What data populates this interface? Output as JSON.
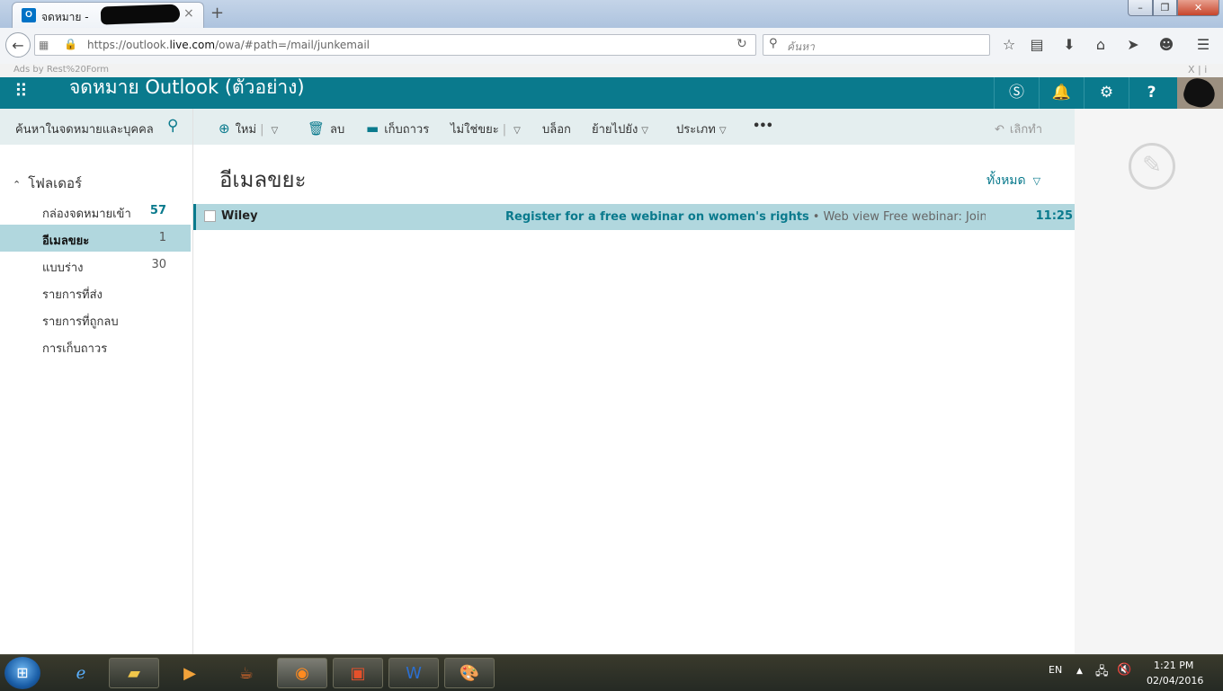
{
  "browser": {
    "tab_title": "จดหมาย -",
    "tab_icon": "O",
    "tab_close": "×",
    "new_tab": "+",
    "url_scheme_host_pre": "https://outlook.",
    "url_host_bold": "live.com",
    "url_path": "/owa/#path=/mail/junkemail",
    "search_placeholder": "ค้นหา",
    "ads_text": "Ads by Rest%20Form",
    "ads_close": "X | i",
    "window": {
      "minimize": "–",
      "maximize": "❐",
      "close": "✕"
    },
    "icons": [
      "back-icon",
      "reload-icon",
      "search-icon",
      "star-icon",
      "reading-list-icon",
      "download-icon",
      "home-icon",
      "send-icon",
      "chat-icon",
      "menu-icon"
    ]
  },
  "app": {
    "title": "จดหมาย Outlook (ตัวอย่าง)",
    "header_buttons": [
      "skype-icon",
      "bell-icon",
      "gear-icon",
      "help-icon"
    ],
    "help_label": "?",
    "brand_color": "#0a7a8d"
  },
  "left": {
    "search_placeholder": "ค้นหาในจดหมายและบุคคล",
    "folders_heading": "โฟลเดอร์",
    "folders": [
      {
        "name": "กล่องจดหมายเข้า",
        "count": "57"
      },
      {
        "name": "อีเมลขยะ",
        "count": "1"
      },
      {
        "name": "แบบร่าง",
        "count": "30"
      },
      {
        "name": "รายการที่ส่ง",
        "count": ""
      },
      {
        "name": "รายการที่ถูกลบ",
        "count": ""
      },
      {
        "name": "การเก็บถาวร",
        "count": ""
      }
    ],
    "selected_folder": "อีเมลขยะ"
  },
  "toolbar": {
    "new": "ใหม่",
    "delete": "ลบ",
    "archive": "เก็บถาวร",
    "not_junk": "ไม่ใช่ขยะ",
    "block": "บล็อก",
    "move_to": "ย้ายไปยัง",
    "categories": "ประเภท",
    "more": "•••",
    "undo": "เลิกทำ"
  },
  "list": {
    "title": "อีเมลขยะ",
    "filter": "ทั้งหมด",
    "messages": [
      {
        "sender": "Wiley",
        "subject": "Register for a free webinar on women's rights",
        "separator": "•",
        "preview": "Web view  Free webinar: Join our expert panel for a discussion",
        "time": "11:25"
      }
    ]
  },
  "taskbar": {
    "apps": [
      "windows-explorer",
      "internet-explorer",
      "file-explorer",
      "media-player",
      "java",
      "firefox",
      "powerpoint",
      "word",
      "paint"
    ],
    "language": "EN",
    "time": "1:21 PM",
    "date": "02/04/2016"
  }
}
